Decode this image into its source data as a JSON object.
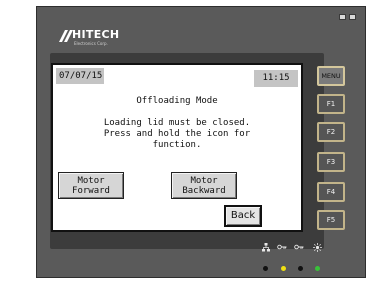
{
  "device": {
    "brand": "HITECH",
    "brand_sub": "Electronics Corp.",
    "colors": {
      "casing": "#5a5a5a",
      "bezel": "#3c3c3c",
      "key_border": "#c2b48a"
    }
  },
  "window_controls": [
    "restore-icon",
    "close-icon"
  ],
  "screen": {
    "date": "07/07/15",
    "time": "11:15",
    "mode_title": "Offloading Mode",
    "message_lines": [
      "Loading lid must be closed.",
      "Press and hold the icon for",
      "function."
    ],
    "motor_forward_lines": [
      "Motor",
      "Forward"
    ],
    "motor_backward_lines": [
      "Motor",
      "Backward"
    ],
    "back_label": "Back"
  },
  "function_keys": [
    "MENU",
    "F1",
    "F2",
    "F3",
    "F4",
    "F5"
  ],
  "indicators": {
    "icons": [
      "network-icon",
      "key-icon",
      "key-icon",
      "power-icon"
    ],
    "leds": [
      {
        "name": "led-1",
        "color": "#111111"
      },
      {
        "name": "led-2",
        "color": "#f0e012"
      },
      {
        "name": "led-3",
        "color": "#111111"
      },
      {
        "name": "led-4",
        "color": "#39c23a"
      }
    ]
  }
}
